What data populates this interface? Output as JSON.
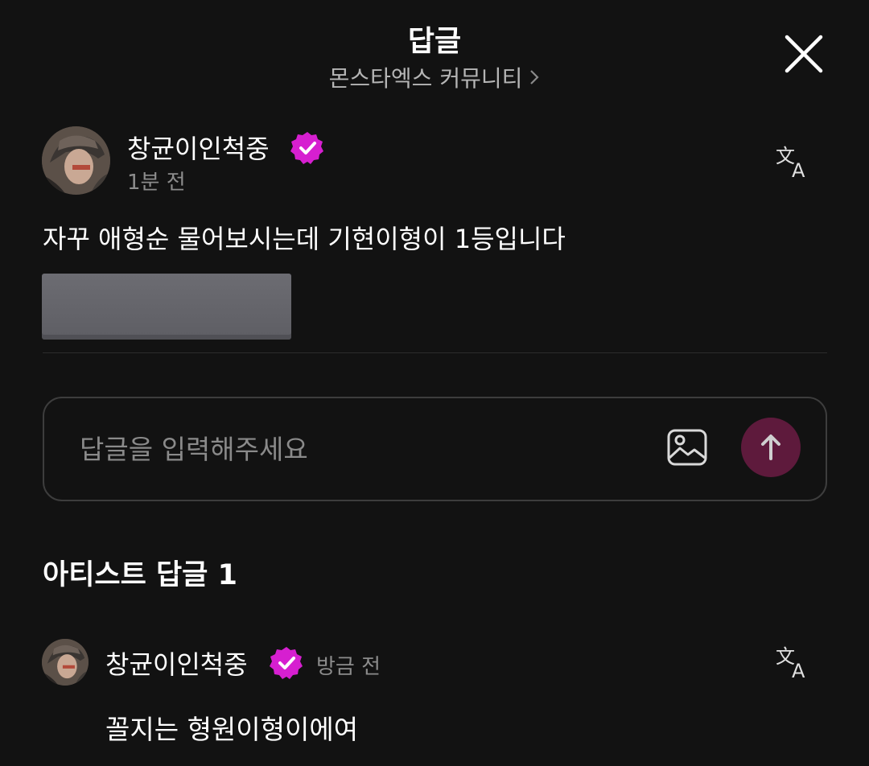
{
  "header": {
    "title": "답글",
    "community": "몬스타엑스 커뮤니티"
  },
  "post": {
    "author": "창균이인척중",
    "time": "1분 전",
    "body": "자꾸 애형순 물어보시는데 기현이형이 1등입니다"
  },
  "reply_input": {
    "placeholder": "답글을 입력해주세요"
  },
  "section": {
    "title": "아티스트 답글 1"
  },
  "artist_reply": {
    "author": "창균이인척중",
    "time": "방금 전",
    "body": "꼴지는 형원이형이에여"
  },
  "colors": {
    "background": "#121212",
    "badge": "#d61fd0",
    "send_button": "#5e1a3c",
    "muted_text": "#8c8c8c"
  },
  "icons": [
    "close-icon",
    "chevron-right-icon",
    "verified-badge-icon",
    "translate-icon",
    "image-icon",
    "send-arrow-icon"
  ]
}
